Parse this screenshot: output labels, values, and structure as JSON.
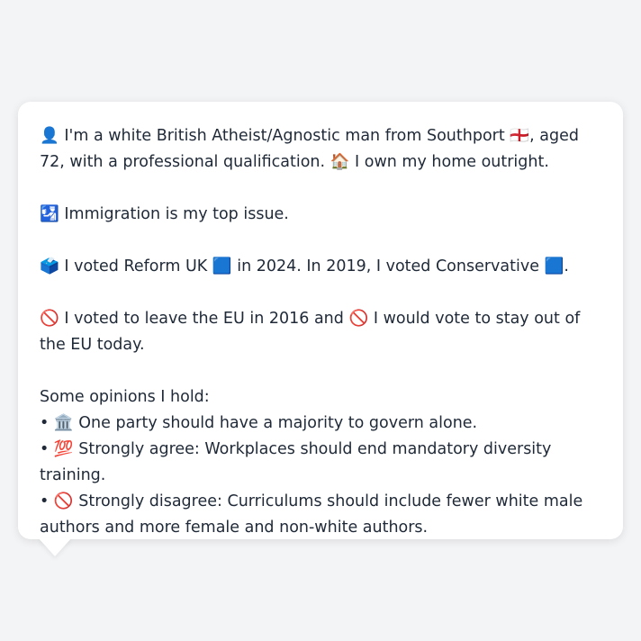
{
  "persona": {
    "identity": {
      "icon": "👤",
      "text_1": "I'm a white British Atheist/Agnostic man from Southport",
      "flag": "🏴󠁧󠁢󠁥󠁮󠁧󠁿",
      "text_2": ", aged 72, with a professional qualification.",
      "home_icon": "🏠",
      "text_3": "I own my home outright."
    },
    "top_issue": {
      "icon": "🛂",
      "text": "Immigration is my top issue."
    },
    "vote": {
      "icon": "🗳️",
      "text_1": "I voted Reform UK",
      "party_1_icon": "🟦",
      "text_2": "in 2024. In 2019, I voted Conservative",
      "party_2_icon": "🟦",
      "text_3": "."
    },
    "eu": {
      "icon_1": "🚫",
      "text_1": "I voted to leave the EU in 2016 and",
      "icon_2": "🚫",
      "text_2": "I would vote to stay out of the EU today."
    },
    "opinions": {
      "heading": "Some opinions I hold:",
      "items": [
        {
          "bullet": "•",
          "icon": "🏛️",
          "text": "One party should have a majority to govern alone."
        },
        {
          "bullet": "•",
          "icon": "💯",
          "text": "Strongly agree: Workplaces should end mandatory diversity training."
        },
        {
          "bullet": "•",
          "icon": "🚫",
          "text": "Strongly disagree: Curriculums should include fewer white male authors and more female and non-white authors."
        }
      ]
    }
  }
}
